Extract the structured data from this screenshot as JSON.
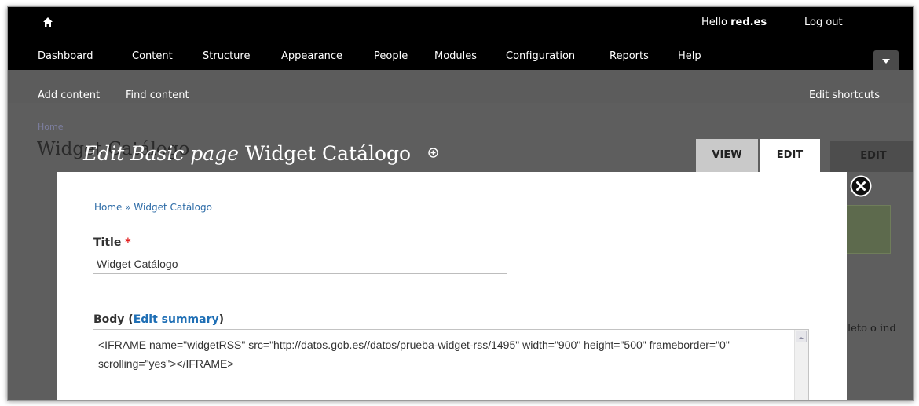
{
  "toolbar": {
    "nav": [
      "Dashboard",
      "Content",
      "Structure",
      "Appearance",
      "People",
      "Modules",
      "Configuration",
      "Reports",
      "Help"
    ],
    "hello_prefix": "Hello ",
    "username": "red.es",
    "logout": "Log out"
  },
  "shortcuts": {
    "add_content": "Add content",
    "find_content": "Find content",
    "edit_shortcuts": "Edit shortcuts"
  },
  "background_page": {
    "breadcrumb": "Home",
    "title": "Widget Catálogo",
    "tab_edit": "EDIT",
    "body_fragment": "leto o ind"
  },
  "overlay": {
    "title_prefix": "Edit Basic page",
    "title_name": "Widget Catálogo",
    "tabs": {
      "view": "VIEW",
      "edit": "EDIT"
    }
  },
  "form": {
    "breadcrumb": {
      "home": "Home",
      "separator": " » ",
      "current": "Widget Catálogo"
    },
    "title_label": "Title",
    "required_mark": "*",
    "title_value": "Widget Catálogo",
    "body_label": "Body",
    "body_label_open": " (",
    "edit_summary": "Edit summary",
    "body_label_close": ")",
    "body_value": "<IFRAME name=\"widgetRSS\" src=\"http://datos.gob.es//datos/prueba-widget-rss/1495\" width=\"900\" height=\"500\" frameborder=\"0\" scrolling=\"yes\"></IFRAME>"
  },
  "icons": {
    "home": "home-icon",
    "shortcut_add": "plus-circle-icon",
    "close": "close-icon",
    "toggle": "chevron-down-icon"
  }
}
